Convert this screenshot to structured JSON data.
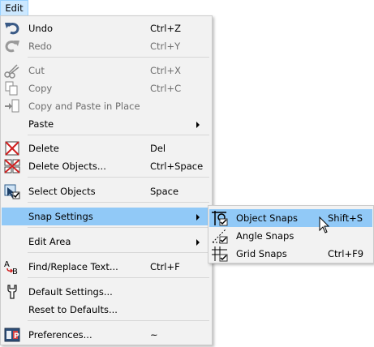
{
  "menubar": {
    "edit_label": "Edit"
  },
  "main_menu": {
    "undo": {
      "label": "Undo",
      "shortcut": "Ctrl+Z"
    },
    "redo": {
      "label": "Redo",
      "shortcut": "Ctrl+Y"
    },
    "cut": {
      "label": "Cut",
      "shortcut": "Ctrl+X"
    },
    "copy": {
      "label": "Copy",
      "shortcut": "Ctrl+C"
    },
    "copy_paste": {
      "label": "Copy and Paste in Place"
    },
    "paste": {
      "label": "Paste"
    },
    "delete": {
      "label": "Delete",
      "shortcut": "Del"
    },
    "delete_objects": {
      "label": "Delete Objects...",
      "shortcut": "Ctrl+Space"
    },
    "select_objects": {
      "label": "Select Objects",
      "shortcut": "Space"
    },
    "snap_settings": {
      "label": "Snap Settings"
    },
    "edit_area": {
      "label": "Edit Area"
    },
    "find_replace": {
      "label": "Find/Replace Text...",
      "shortcut": "Ctrl+F"
    },
    "default_settings": {
      "label": "Default Settings..."
    },
    "reset_defaults": {
      "label": "Reset to Defaults..."
    },
    "preferences": {
      "label": "Preferences...",
      "shortcut": "~"
    }
  },
  "snap_submenu": {
    "object_snaps": {
      "label": "Object Snaps",
      "shortcut": "Shift+S"
    },
    "angle_snaps": {
      "label": "Angle Snaps"
    },
    "grid_snaps": {
      "label": "Grid Snaps",
      "shortcut": "Ctrl+F9"
    }
  },
  "colors": {
    "highlight": "#91c9f7",
    "menu_bg": "#f2f2f2",
    "disabled_text": "#6d6d6d",
    "title_active": "#cce8ff"
  },
  "icons": {
    "undo": "undo-icon",
    "redo": "redo-icon",
    "cut": "scissors-icon",
    "copy": "copy-icon",
    "copy_paste": "copy-paste-icon",
    "delete": "delete-icon",
    "delete_objects": "delete-objects-icon",
    "select_objects": "select-objects-icon",
    "find_replace": "find-replace-icon",
    "default_settings": "default-settings-icon",
    "preferences": "preferences-icon",
    "object_snaps": "object-snaps-icon",
    "angle_snaps": "angle-snaps-icon",
    "grid_snaps": "grid-snaps-icon"
  }
}
